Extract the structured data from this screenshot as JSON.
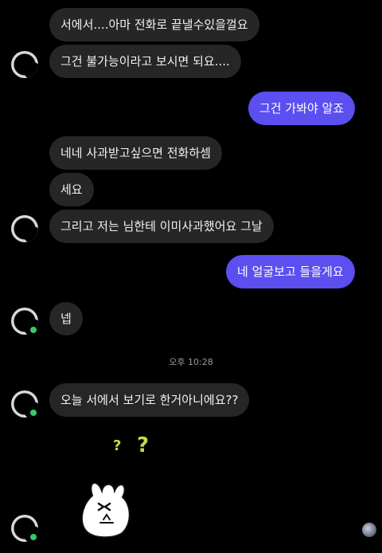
{
  "messages": {
    "m1": "서에서....아마 전화로 끝낼수있을껄요",
    "m2": "그건 불가능이라고 보시면 되요....",
    "m3": "그건 가봐야 알죠",
    "m4": "네네 사과받고싶으면 전화하셈",
    "m5": "세요",
    "m6": "그리고 저는 님한테 이미사과했어요 그날",
    "m7": "네 얼굴보고 들을게요",
    "m8": "넵",
    "m9": "오늘 서에서 보기로 한거아니에요??"
  },
  "timestamp": "오후 10:28",
  "sticker": {
    "question_marks": [
      "?",
      "?"
    ]
  },
  "colors": {
    "incoming_bubble": "#262626",
    "outgoing_bubble": "#5b4ff0",
    "online_dot": "#38c96a"
  }
}
